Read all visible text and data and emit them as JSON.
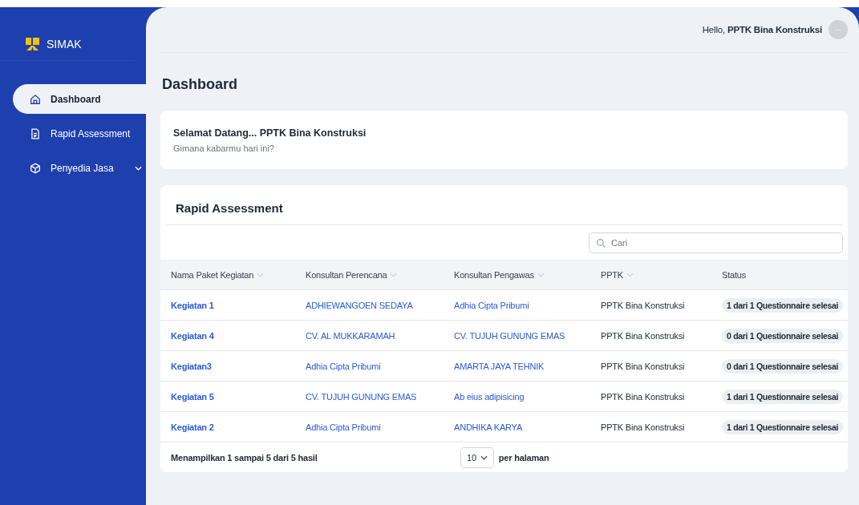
{
  "app": {
    "name": "SIMAK"
  },
  "sidebar": {
    "items": [
      {
        "label": "Dashboard",
        "selected": true,
        "expandable": false
      },
      {
        "label": "Rapid Assessment",
        "selected": false,
        "expandable": false
      },
      {
        "label": "Penyedia Jasa",
        "selected": false,
        "expandable": true
      }
    ]
  },
  "header": {
    "greeting": "Hello, **PPTK Bina Konstruksi**"
  },
  "page_title": "Dashboard",
  "welcome": {
    "title": "Selamat Datang... PPTK Bina Konstruksi",
    "subtitle": "Gimana kabarmu hari ini?"
  },
  "table": {
    "title": "Rapid Assessment",
    "search": {
      "placeholder": "Cari"
    },
    "columns": [
      {
        "label": "Nama Paket Kegiatan",
        "sortable": true
      },
      {
        "label": "Konsultan Perencana",
        "sortable": true
      },
      {
        "label": "Konsultan Pengawas",
        "sortable": true
      },
      {
        "label": "PPTK",
        "sortable": true
      },
      {
        "label": "Status",
        "sortable": false
      }
    ],
    "rows": [
      [
        "Kegiatan 1",
        "ADHIEWANGOEN SEDAYA",
        "Adhia Cipta Pribumi",
        "PPTK Bina Konstruksi",
        "1 dari 1 Questionnaire selesai"
      ],
      [
        "Kegiatan 4",
        "CV. AL MUKKARAMAH",
        "CV. TUJUH GUNUNG EMAS",
        "PPTK Bina Konstruksi",
        "0 dari 1 Questionnaire selesai"
      ],
      [
        "Kegiatan3",
        "Adhia Cipta Pribumi",
        "AMARTA JAYA TEHNIK",
        "PPTK Bina Konstruksi",
        "0 dari 1 Questionnaire selesai"
      ],
      [
        "Kegiatan 5",
        "CV. TUJUH GUNUNG EMAS",
        "Ab eius adipisicing",
        "PPTK Bina Konstruksi",
        "1 dari 1 Questionnaire selesai"
      ],
      [
        "Kegiatan 2",
        "Adhia Cipta Pribumi",
        "ANDHIKA KARYA",
        "PPTK Bina Konstruksi",
        "1 dari 1 Questionnaire selesai"
      ]
    ],
    "footer": {
      "summary": "Menampilkan 1 sampai 5 dari 5 hasil",
      "page_size": "10",
      "page_size_label": "per halaman"
    }
  }
}
